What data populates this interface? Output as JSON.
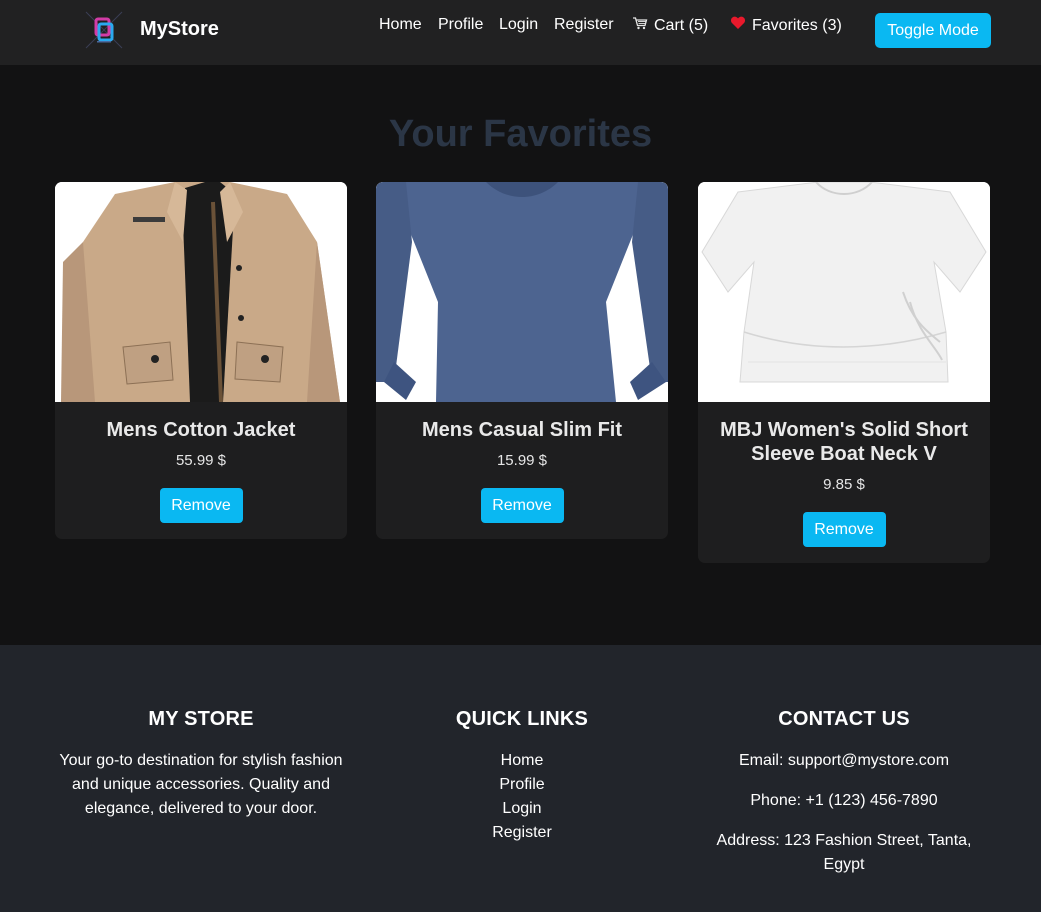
{
  "nav": {
    "brand": "MyStore",
    "home": "Home",
    "profile": "Profile",
    "login": "Login",
    "register": "Register",
    "cart": "Cart (5)",
    "favorites": "Favorites (3)",
    "toggle": "Toggle Mode"
  },
  "main": {
    "title": "Your Favorites",
    "products": [
      {
        "name": "Mens Cotton Jacket",
        "price": "55.99 $",
        "remove": "Remove"
      },
      {
        "name": "Mens Casual Slim Fit",
        "price": "15.99 $",
        "remove": "Remove"
      },
      {
        "name": "MBJ Women's Solid Short Sleeve Boat Neck V",
        "price": "9.85 $",
        "remove": "Remove"
      }
    ]
  },
  "footer": {
    "about": {
      "heading": "MY STORE",
      "text": "Your go-to destination for stylish fashion and unique accessories. Quality and elegance, delivered to your door."
    },
    "links": {
      "heading": "QUICK LINKS",
      "items": [
        "Home",
        "Profile",
        "Login",
        "Register"
      ]
    },
    "contact": {
      "heading": "CONTACT US",
      "email": "Email: support@mystore.com",
      "phone": "Phone: +1 (123) 456-7890",
      "address": "Address: 123 Fashion Street, Tanta, Egypt"
    }
  },
  "colors": {
    "accent": "#0ab8f2",
    "navbar": "#212122",
    "background": "#121213",
    "card": "#1e1e1f",
    "footer": "#22252b",
    "title": "#2b3646"
  },
  "icons": {
    "logo": "store-logo-icon",
    "cart": "cart-icon",
    "favorites": "heart-icon"
  }
}
